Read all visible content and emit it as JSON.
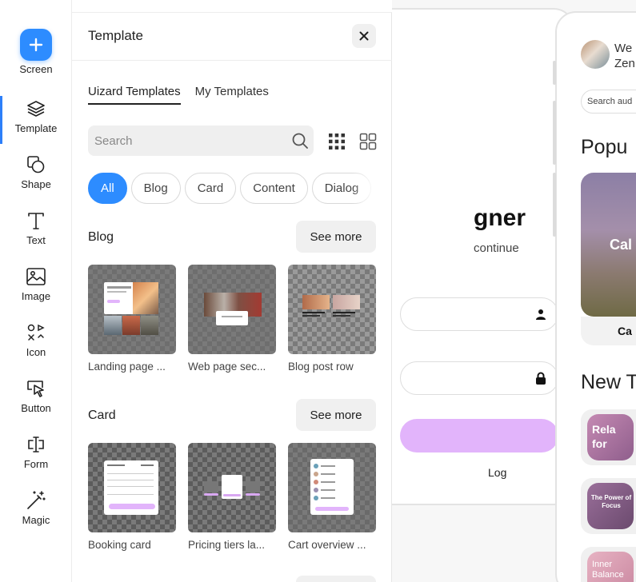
{
  "toolbar": {
    "items": [
      {
        "label": "Screen",
        "icon": "plus-icon"
      },
      {
        "label": "Template",
        "icon": "layers-icon"
      },
      {
        "label": "Shape",
        "icon": "shape-icon"
      },
      {
        "label": "Text",
        "icon": "text-icon"
      },
      {
        "label": "Image",
        "icon": "image-icon"
      },
      {
        "label": "Icon",
        "icon": "icons-icon"
      },
      {
        "label": "Button",
        "icon": "pointer-icon"
      },
      {
        "label": "Form",
        "icon": "form-icon"
      },
      {
        "label": "Magic",
        "icon": "magic-wand-icon"
      }
    ]
  },
  "panel": {
    "title": "Template",
    "tabs": [
      "Uizard Templates",
      "My Templates"
    ],
    "search_placeholder": "Search",
    "chips": [
      "All",
      "Blog",
      "Card",
      "Content",
      "Dialog"
    ],
    "sections": [
      {
        "title": "Blog",
        "see_more": "See more",
        "cards": [
          "Landing page ...",
          "Web page sec...",
          "Blog post row"
        ]
      },
      {
        "title": "Card",
        "see_more": "See more",
        "cards": [
          "Booking card",
          "Pricing tiers la...",
          "Cart overview ..."
        ]
      }
    ]
  },
  "screen1": {
    "heading": "gner",
    "subtitle": "continue",
    "button_label": "Log",
    "accent": "#e2b4fb"
  },
  "screen2": {
    "greeting_line1": "We",
    "greeting_line2": "Zen",
    "search_placeholder": "Search aud",
    "popular_heading": "Popu",
    "featured_label": "Cal",
    "featured_caption": "Ca",
    "new_heading": "New T",
    "items": [
      "Rela for",
      "The Power of Focus",
      "Inner Balance"
    ]
  },
  "colors": {
    "accent": "#2d8cff",
    "chip_active": "#2d8cff"
  }
}
